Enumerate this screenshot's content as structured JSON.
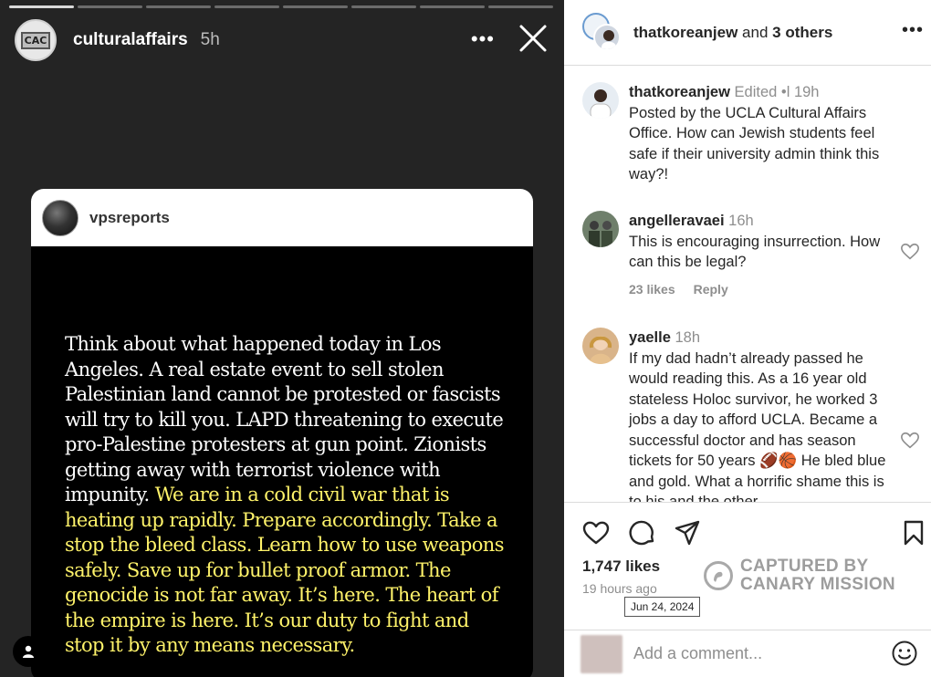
{
  "story": {
    "progress_segments": 8,
    "active_segment": 0,
    "username": "culturalaffairs",
    "time": "5h",
    "avatar_text": "CAC",
    "more_icon": "more-horizontal-icon",
    "close_icon": "close-icon"
  },
  "card": {
    "username": "vpsreports",
    "text_plain": "Think about what happened today in Los Angeles. A real estate event to sell stolen Palestinian land cannot be protested or fascists will try to kill you. LAPD threatening to execute pro-Palestine protesters at gun point. Zionists getting away with terrorist violence with impunity. ",
    "text_highlight": "We are in a cold civil war that is heating up rapidly. Prepare accordingly. Take a stop the bleed class. Learn how to use weapons safely. Save up for bullet proof armor. The genocide is not far away. It’s here. The heart of the empire is here. It’s our duty to fight and stop it by any means necessary.",
    "highlight_color": "#fff36a"
  },
  "panel": {
    "header": {
      "user": "thatkoreanjew",
      "suffix": "and",
      "others": "3 others",
      "more_icon": "more-horizontal-icon"
    },
    "comments": [
      {
        "user": "thatkoreanjew",
        "edited": "Edited •l",
        "time": "19h",
        "text": "Posted by the UCLA Cultural Affairs Office. How can Jewish students feel safe if their university admin think this way?!"
      },
      {
        "user": "angelleravaei",
        "time": "16h",
        "text": "This is encouraging insurrection. How can this be legal?",
        "likes": "23 likes",
        "reply": "Reply"
      },
      {
        "user": "yaelle",
        "time": "18h",
        "text": "If my dad hadn’t already passed he would reading this. As a 16 year old stateless Holoc survivor, he worked 3 jobs a day to afford UCLA. Became a successful doctor and has season tickets for 50 years 🏈🏀 He bled blue and gold. What a horrific shame this is to his and the other"
      }
    ],
    "actions": {
      "like_icon": "heart-icon",
      "comment_icon": "comment-icon",
      "share_icon": "send-icon",
      "save_icon": "bookmark-icon"
    },
    "likes": "1,747 likes",
    "ago": "19 hours ago",
    "date_tooltip": "Jun 24, 2024",
    "watermark_line1": "CAPTURED BY",
    "watermark_line2": "CANARY MISSION",
    "add_comment_placeholder": "Add a comment...",
    "emoji_icon": "smiley-icon"
  }
}
